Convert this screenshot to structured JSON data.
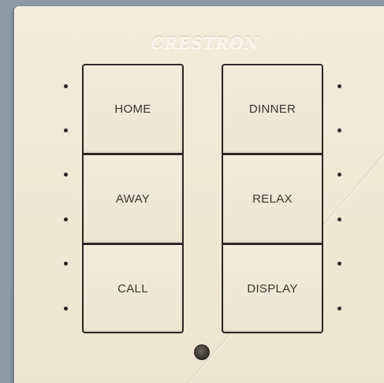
{
  "keypad": {
    "brand": "CRESTRON",
    "buttons": {
      "home": "HOME",
      "away": "AWAY",
      "call": "CALL",
      "dinner": "DINNER",
      "relax": "RELAX",
      "display": "DISPLAY"
    },
    "colors": {
      "faceplate": "#efe8d5",
      "button_border": "#2b2722",
      "label": "#3a352e",
      "background": "#8c9aa6"
    }
  }
}
